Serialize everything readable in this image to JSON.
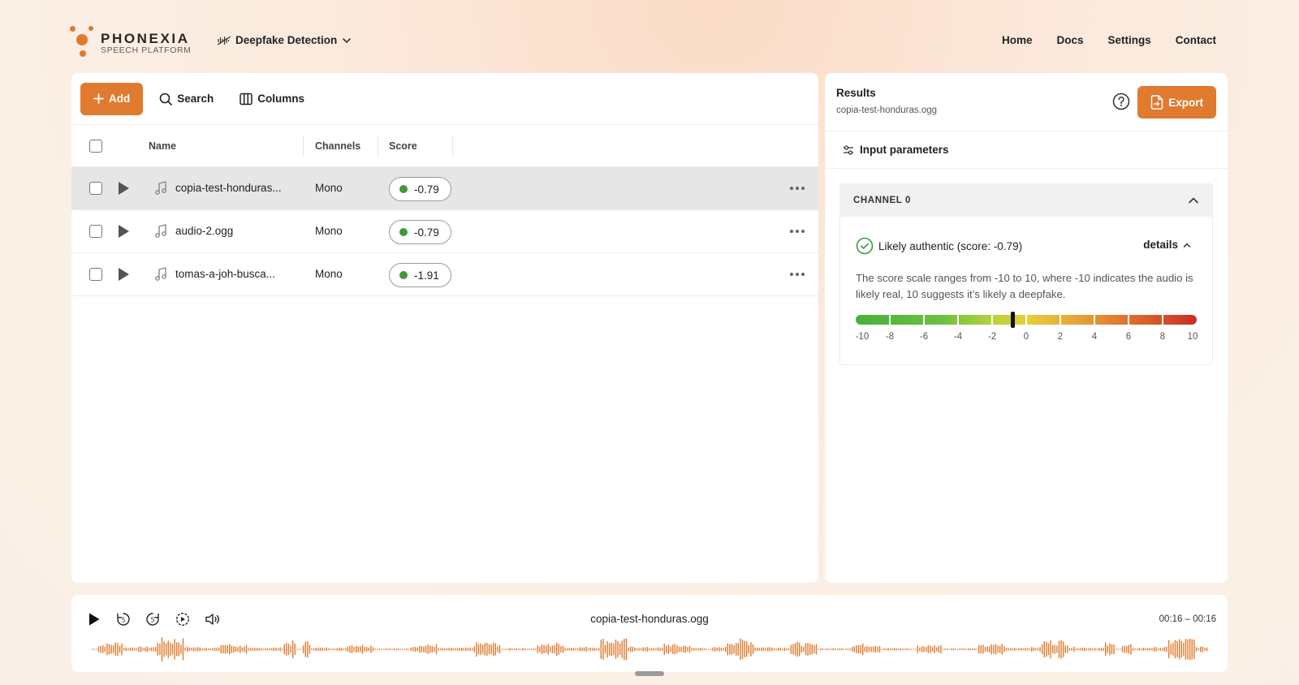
{
  "brand": {
    "name": "PHONEXIA",
    "subtitle": "SPEECH PLATFORM"
  },
  "app_switcher": {
    "label": "Deepfake Detection"
  },
  "nav": [
    "Home",
    "Docs",
    "Settings",
    "Contact"
  ],
  "toolbar": {
    "add_label": "Add",
    "search_label": "Search",
    "columns_label": "Columns"
  },
  "table": {
    "columns": [
      "Name",
      "Channels",
      "Score"
    ],
    "rows": [
      {
        "name": "copia-test-honduras...",
        "channels": "Mono",
        "score": "-0.79",
        "selected": true
      },
      {
        "name": "audio-2.ogg",
        "channels": "Mono",
        "score": "-0.79",
        "selected": false
      },
      {
        "name": "tomas-a-joh-busca...",
        "channels": "Mono",
        "score": "-1.91",
        "selected": false
      }
    ]
  },
  "results": {
    "title": "Results",
    "file": "copia-test-honduras.ogg",
    "export_label": "Export",
    "input_params_label": "Input parameters",
    "channel": {
      "title": "CHANNEL 0",
      "verdict": "Likely authentic (score: -0.79)",
      "details_label": "details",
      "description": "The score scale ranges from -10 to 10, where -10 indicates the audio is likely real, 10 suggests it’s likely a deepfake.",
      "score": -0.79,
      "scale_min": -10,
      "scale_max": 10,
      "scale_labels": [
        "-10",
        "-8",
        "-6",
        "-4",
        "-2",
        "0",
        "2",
        "4",
        "6",
        "8",
        "10"
      ]
    }
  },
  "player": {
    "file": "copia-test-honduras.ogg",
    "time": "00:16 – 00:16"
  },
  "colors": {
    "accent": "#e07a2e",
    "authentic": "#3f9a3a",
    "waveform": "#e07a2e"
  }
}
